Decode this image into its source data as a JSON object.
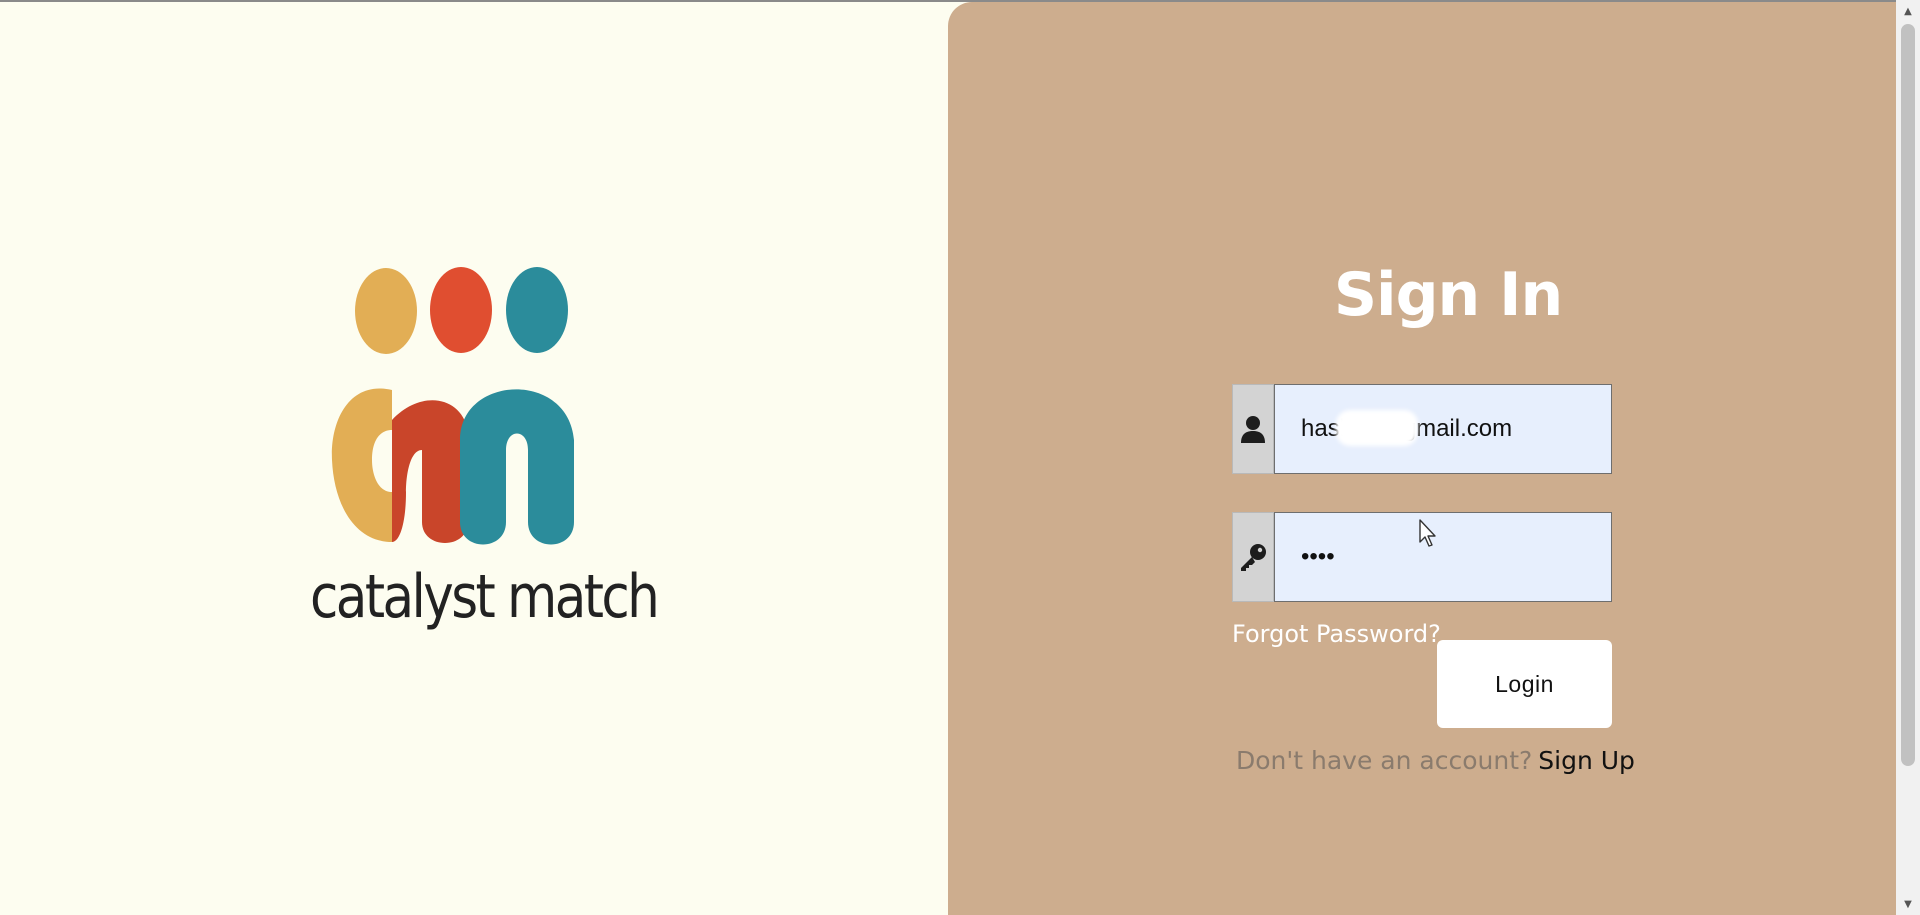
{
  "brand": {
    "name": "catalyst match",
    "colors": {
      "yellow": "#e2ae55",
      "red": "#e04e30",
      "teal": "#2b8c9b",
      "dark_red": "#c9452a"
    }
  },
  "form": {
    "title": "Sign In",
    "email": {
      "icon": "user-icon",
      "value": "hashmi@gmail.com",
      "placeholder": ""
    },
    "password": {
      "icon": "key-icon",
      "value": "••••",
      "placeholder": ""
    },
    "forgot_label": "Forgot Password?",
    "login_label": "Login",
    "signup_prompt": "Don't have an account?",
    "signup_label": "Sign Up"
  },
  "colors": {
    "page_bg": "#fdfdf0",
    "panel_bg": "#cdad8e",
    "input_bg": "#e7effd",
    "addon_bg": "#d3d3d3",
    "title_text": "#ffffff"
  },
  "scrollbar": {
    "up_icon": "scroll-up-arrow-icon",
    "down_icon": "scroll-down-arrow-icon"
  }
}
